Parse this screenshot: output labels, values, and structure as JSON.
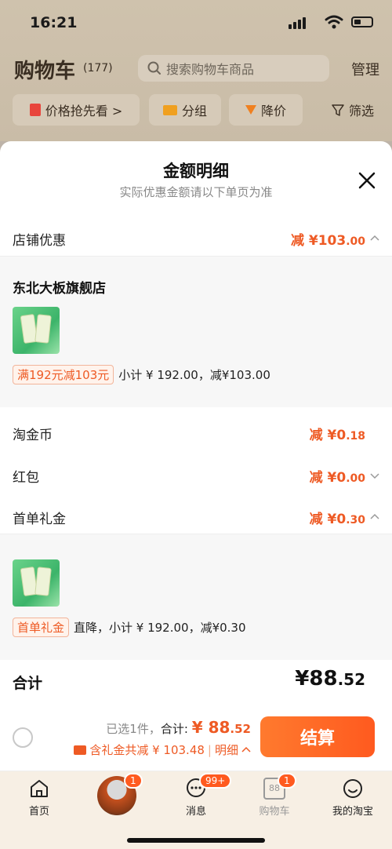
{
  "status": {
    "time": "16:21"
  },
  "header": {
    "title": "购物车",
    "count": "(177)",
    "search_placeholder": "搜索购物车商品",
    "manage": "管理"
  },
  "filters": [
    {
      "label": "价格抢先看 >",
      "icon": "price-tag-icon"
    },
    {
      "label": "分组",
      "icon": "folder-icon"
    },
    {
      "label": "降价",
      "icon": "down-arrow-icon"
    },
    {
      "label": "筛选",
      "icon": "filter-icon"
    }
  ],
  "sheet": {
    "title": "金额明细",
    "subtitle": "实际优惠金额请以下单页为准",
    "shop_discount": {
      "label": "店铺优惠",
      "prefix": "减 ¥",
      "int": "103",
      "dec": ".00"
    },
    "shop": {
      "name": "东北大板旗舰店",
      "promo_tag": "满192元减103元",
      "promo_text": "小计 ¥ 192.00，减¥103.00"
    },
    "coins": {
      "label": "淘金币",
      "prefix": "减 ¥",
      "int": "0",
      "dec": ".18"
    },
    "redpacket": {
      "label": "红包",
      "prefix": "减 ¥",
      "int": "0",
      "dec": ".00"
    },
    "first_gift": {
      "label": "首单礼金",
      "prefix": "减 ¥",
      "int": "0",
      "dec": ".30"
    },
    "gift_item": {
      "tag": "首单礼金",
      "text": "直降，小计 ¥ 192.00，减¥0.30"
    },
    "total": {
      "label": "合计",
      "prefix": "¥",
      "int": "88",
      "dec": ".52"
    }
  },
  "checkout": {
    "selected": "已选1件，",
    "sum_label": "合计:",
    "price_prefix": "¥ ",
    "price_int": "88",
    "price_dec": ".52",
    "discount_text": "含礼金共减 ¥ 103.48",
    "detail": "明细",
    "pay_button": "结算"
  },
  "tabbar": {
    "home": "首页",
    "messages": "消息",
    "messages_badge": "99+",
    "cart": "购物车",
    "cart_badge": "1",
    "cart_icon_text": "88",
    "avatar_badge": "1",
    "mytaobao": "我的淘宝"
  },
  "colors": {
    "accent": "#ee5a24",
    "pay_button": "#ff5a1f"
  }
}
